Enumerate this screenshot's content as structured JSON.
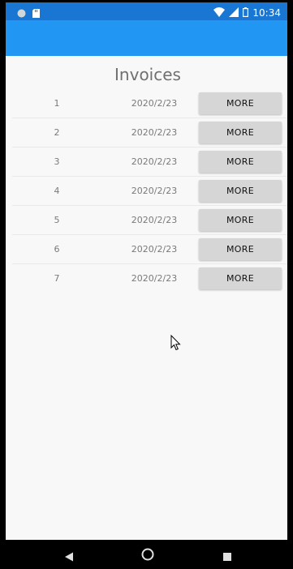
{
  "status_bar": {
    "time": "10:34",
    "bg_color": "#1976d2",
    "left_icons": [
      "sync-icon",
      "sd-card-icon"
    ],
    "right_icons": [
      "wifi-icon",
      "cellular-icon",
      "battery-icon"
    ]
  },
  "app_bar": {
    "bg_color": "#2196f3"
  },
  "page": {
    "title": "Invoices"
  },
  "invoices": [
    {
      "number": "1",
      "date": "2020/2/23",
      "button": "MORE"
    },
    {
      "number": "2",
      "date": "2020/2/23",
      "button": "MORE"
    },
    {
      "number": "3",
      "date": "2020/2/23",
      "button": "MORE"
    },
    {
      "number": "4",
      "date": "2020/2/23",
      "button": "MORE"
    },
    {
      "number": "5",
      "date": "2020/2/23",
      "button": "MORE"
    },
    {
      "number": "6",
      "date": "2020/2/23",
      "button": "MORE"
    },
    {
      "number": "7",
      "date": "2020/2/23",
      "button": "MORE"
    }
  ],
  "nav_bar": {
    "buttons": [
      "back-icon",
      "home-icon",
      "recents-icon"
    ]
  }
}
